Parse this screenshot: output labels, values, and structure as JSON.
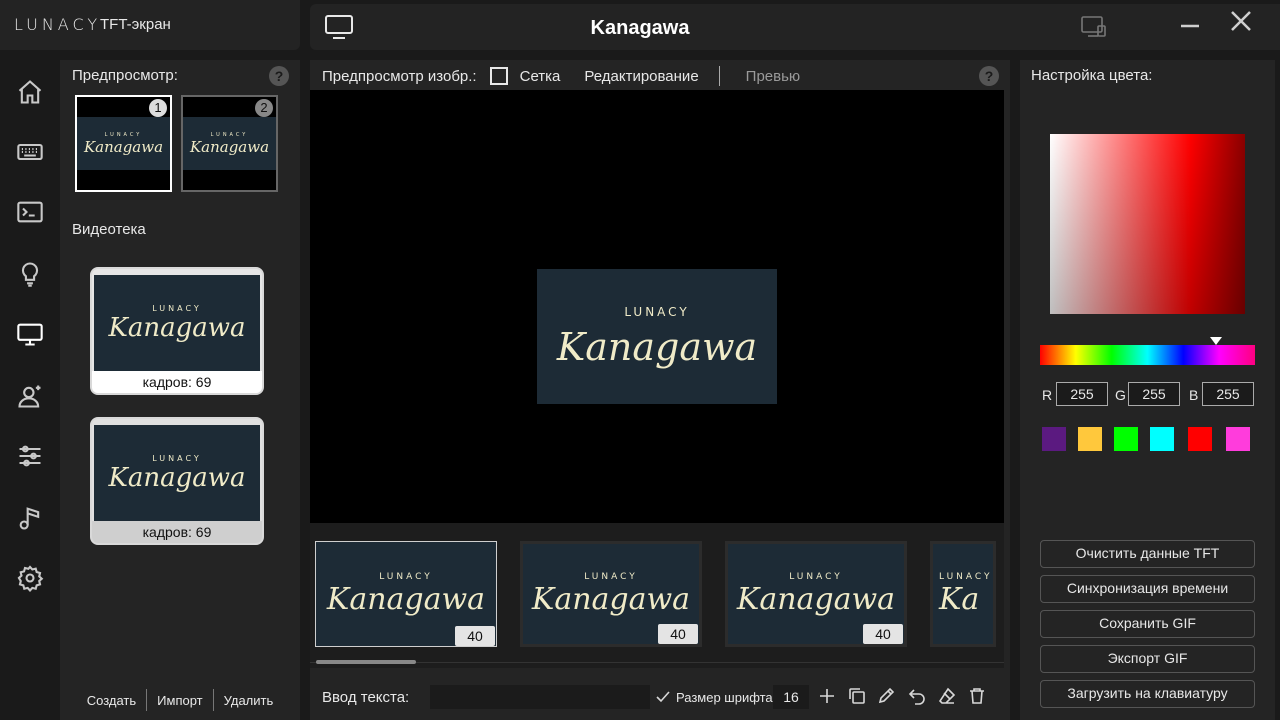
{
  "app": {
    "logo": "LUNACY",
    "subtitle": "TFT-экран",
    "window_title": "Kanagawa"
  },
  "nav": {
    "items": [
      "home-icon",
      "keyboard-icon",
      "terminal-icon",
      "lightbulb-icon",
      "monitor-icon",
      "user-icon",
      "sliders-icon",
      "music-icon",
      "gear-icon"
    ],
    "active": "monitor-icon"
  },
  "left_panel": {
    "preview_label": "Предпросмотр:",
    "help": "?",
    "thumbs": [
      {
        "num": "1",
        "logo": "LUNACY",
        "title": "Kanagawa"
      },
      {
        "num": "2",
        "logo": "LUNACY",
        "title": "Kanagawa"
      }
    ],
    "library_label": "Видеотека",
    "videos": [
      {
        "logo": "LUNACY",
        "title": "Kanagawa",
        "caption": "кадров: 69"
      },
      {
        "logo": "LUNACY",
        "title": "Kanagawa",
        "caption": "кадров: 69"
      }
    ],
    "footer": {
      "create": "Создать",
      "import": "Импорт",
      "delete": "Удалить"
    }
  },
  "center": {
    "toolbar": {
      "preview_img": "Предпросмотр изобр.:",
      "grid": "Сетка",
      "edit": "Редактирование",
      "preview": "Превью",
      "help": "?"
    },
    "canvas": {
      "logo": "LUNACY",
      "title": "Kanagawa"
    },
    "frames": [
      {
        "logo": "LUNACY",
        "title": "Kanagawa",
        "badge": "40"
      },
      {
        "logo": "LUNACY",
        "title": "Kanagawa",
        "badge": "40"
      },
      {
        "logo": "LUNACY",
        "title": "Kanagawa",
        "badge": "40"
      },
      {
        "logo": "LUNACY",
        "title": "Ka",
        "badge": ""
      }
    ],
    "text_row": {
      "label": "Ввод текста:",
      "placeholder": "",
      "font_size_label": "Размер шрифта",
      "font_size": "16"
    }
  },
  "right_panel": {
    "label": "Настройка цвета:",
    "rgb": {
      "r_label": "R",
      "r": "255",
      "g_label": "G",
      "g": "255",
      "b_label": "B",
      "b": "255"
    },
    "swatches": [
      "#5b1a80",
      "#ffc83c",
      "#00ff00",
      "#00ffff",
      "#ff0000",
      "#ff3cdc"
    ],
    "buttons": {
      "clear": "Очистить данные TFT",
      "sync": "Синхронизация времени",
      "save_gif": "Сохранить GIF",
      "export_gif": "Экспорт GIF",
      "upload": "Загрузить на клавиатуру"
    }
  }
}
